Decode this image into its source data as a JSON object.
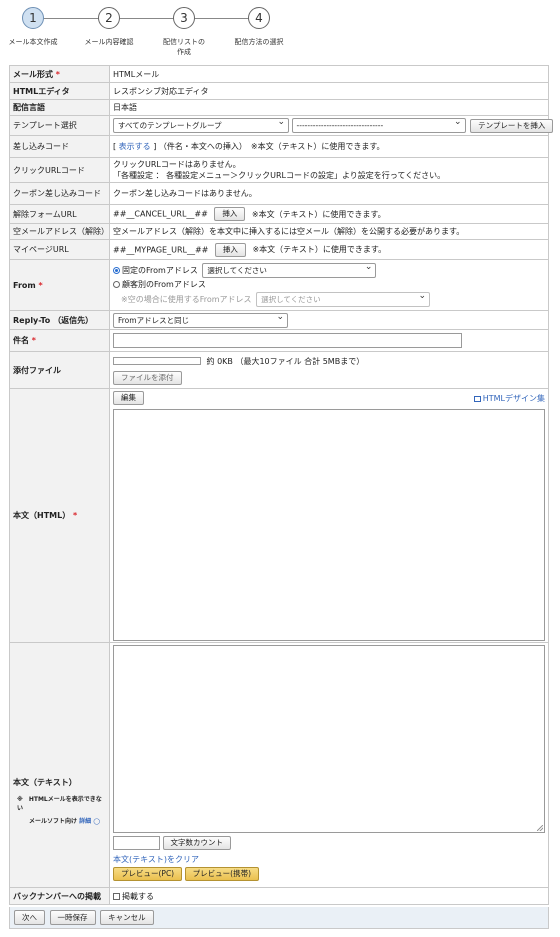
{
  "steps": [
    {
      "num": "1",
      "label": "メール本文作成"
    },
    {
      "num": "2",
      "label": "メール内容確認"
    },
    {
      "num": "3",
      "label": "配信リストの\n作成"
    },
    {
      "num": "4",
      "label": "配信方法の選択"
    }
  ],
  "mail_format": {
    "label": "メール形式",
    "value": "HTMLメール"
  },
  "html_editor": {
    "label": "HTMLエディタ",
    "value": "レスポンシブ対応エディタ"
  },
  "language": {
    "label": "配信言語",
    "value": "日本語"
  },
  "template": {
    "label": "テンプレート選択",
    "group_select": "すべてのテンプレートグループ",
    "template_select": "--------------------------------",
    "insert_button": "テンプレートを挿入"
  },
  "merge_code": {
    "label": "差し込みコード",
    "show_link": "表示する",
    "bracket_open": "[",
    "bracket_close": "]",
    "note": "（件名・本文への挿入）　※本文（テキスト）に使用できます。"
  },
  "click_url": {
    "label": "クリックURLコード",
    "line1": "クリックURLコードはありません。",
    "line2": "「各種設定 ： 各種設定メニュー＞クリックURLコードの設定」より設定を行ってください。"
  },
  "coupon": {
    "label": "クーポン差し込みコード",
    "value": "クーポン差し込みコードはありません。"
  },
  "cancel_form": {
    "label": "解除フォームURL",
    "code": "##__CANCEL_URL__##",
    "insert_button": "挿入",
    "note": "※本文（テキスト）に使用できます。"
  },
  "empty_mail": {
    "label": "空メールアドレス（解除）",
    "value": "空メールアドレス（解除）を本文中に挿入するには空メール（解除）を公開する必要があります。"
  },
  "mypage": {
    "label": "マイページURL",
    "code": "##__MYPAGE_URL__##",
    "insert_button": "挿入",
    "note": "※本文（テキスト）に使用できます。"
  },
  "from": {
    "label": "From",
    "fixed_label": "固定のFromアドレス",
    "fixed_select": "選択してください",
    "customer_label": "顧客別のFromアドレス",
    "empty_note": "※空の場合に使用するFromアドレス",
    "empty_select": "選択してください"
  },
  "reply_to": {
    "label": "Reply-To （返信先）",
    "value": "Fromアドレスと同じ"
  },
  "subject": {
    "label": "件名",
    "value": ""
  },
  "attachment": {
    "label": "添付ファイル",
    "size_note": "約 0KB （最大10ファイル 合計 5MBまで）",
    "attach_button": "ファイルを添付"
  },
  "body_html": {
    "label": "本文（HTML）",
    "edit_button": "編集",
    "design_link": "HTMLデザイン集"
  },
  "body_text": {
    "label": "本文（テキスト）",
    "note_line1": "※　HTMLメールを表示できない",
    "note_line2": "メールソフト向け",
    "detail_link": "詳細",
    "count_button": "文字数カウント",
    "clear_link": "本文(テキスト)をクリア",
    "preview_pc": "プレビュー(PC)",
    "preview_mobile": "プレビュー(携帯)"
  },
  "backnumber": {
    "label": "バックナンバーへの掲載",
    "checkbox_label": "掲載する"
  },
  "required_mark": "*",
  "footer": {
    "next": "次へ",
    "save": "一時保存",
    "cancel": "キャンセル"
  }
}
